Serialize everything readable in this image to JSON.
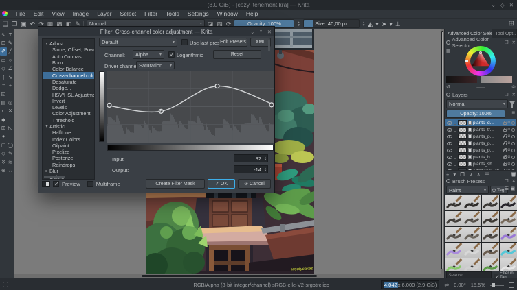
{
  "window": {
    "title": "(3.0 GiB) - [cozy_tenement.kra] — Krita",
    "controls": [
      {
        "name": "minimize",
        "glyph": "⌄"
      },
      {
        "name": "maximize",
        "glyph": "◇"
      },
      {
        "name": "close",
        "glyph": "✕"
      }
    ]
  },
  "menubar": {
    "items": [
      "File",
      "Edit",
      "View",
      "Image",
      "Layer",
      "Select",
      "Filter",
      "Tools",
      "Settings",
      "Window",
      "Help"
    ]
  },
  "toolbar": {
    "left_icons": [
      {
        "name": "new-document",
        "glyph": "❏"
      },
      {
        "name": "open-document",
        "glyph": "❐"
      },
      {
        "name": "save",
        "glyph": "▣"
      },
      {
        "name": "undo",
        "glyph": "↶"
      },
      {
        "name": "redo",
        "glyph": "↷"
      },
      {
        "name": "gradient-chooser",
        "glyph": "▦"
      },
      {
        "name": "pattern-chooser",
        "glyph": "▩"
      },
      {
        "name": "fg-bg-color",
        "glyph": "◧"
      },
      {
        "name": "brush-editor",
        "glyph": "✎"
      }
    ],
    "blend_mode": "Normal",
    "mid_icons": [
      {
        "name": "eraser-mode",
        "glyph": "◪"
      },
      {
        "name": "preserve-alpha",
        "glyph": "▨"
      },
      {
        "name": "reload-preset",
        "glyph": "⟳"
      }
    ],
    "opacity_label": "Opacity: 100%",
    "size_label": "Size: 40,00 px",
    "right_icons": [
      {
        "name": "mirror-horizontal",
        "glyph": "◭"
      },
      {
        "name": "mirror-dropdown",
        "glyph": "▾"
      },
      {
        "name": "mirror-vertical",
        "glyph": "➤"
      },
      {
        "name": "mirror-vertical-dropdown",
        "glyph": "▾"
      },
      {
        "name": "wrap-around",
        "glyph": "⊥"
      }
    ],
    "workspace_icon": "⊞"
  },
  "toolbox": {
    "tools": [
      {
        "name": "select-shapes",
        "glyph": "↖"
      },
      {
        "name": "text",
        "glyph": "T"
      },
      {
        "name": "transform",
        "glyph": "⊡"
      },
      {
        "name": "edit-shapes",
        "glyph": "✎"
      },
      {
        "name": "freehand-brush",
        "glyph": "✐",
        "selected": true
      },
      {
        "name": "line",
        "glyph": "╱"
      },
      {
        "name": "rectangle",
        "glyph": "▭"
      },
      {
        "name": "ellipse",
        "glyph": "○"
      },
      {
        "name": "polygon",
        "glyph": "◇"
      },
      {
        "name": "polyline",
        "glyph": "∠"
      },
      {
        "name": "bezier-curve",
        "glyph": "∫"
      },
      {
        "name": "freehand-path",
        "glyph": "∿"
      },
      {
        "name": "dynamic-brush",
        "glyph": "≈"
      },
      {
        "name": "multibrush",
        "glyph": "+"
      },
      {
        "name": "crop",
        "glyph": "◱"
      },
      {
        "name": "",
        "glyph": ""
      },
      {
        "name": "gradient",
        "glyph": "▤"
      },
      {
        "name": "color-sampler",
        "glyph": "◎"
      },
      {
        "name": "pattern-fill",
        "glyph": "◐"
      },
      {
        "name": "smart-patch",
        "glyph": "✕"
      },
      {
        "name": "fill",
        "glyph": "◆"
      },
      {
        "name": "",
        "glyph": ""
      },
      {
        "name": "assistants",
        "glyph": "⊞"
      },
      {
        "name": "measure",
        "glyph": "◺"
      },
      {
        "name": "reference-images",
        "glyph": "●"
      },
      {
        "name": "",
        "glyph": ""
      },
      {
        "name": "rectangular-select",
        "glyph": "◻"
      },
      {
        "name": "elliptical-select",
        "glyph": "◯"
      },
      {
        "name": "polygonal-select",
        "glyph": "◇"
      },
      {
        "name": "freehand-select",
        "glyph": "✎"
      },
      {
        "name": "contiguous-select",
        "glyph": "※"
      },
      {
        "name": "similar-select",
        "glyph": "≋"
      },
      {
        "name": "zoom",
        "glyph": "⊕"
      },
      {
        "name": "pan",
        "glyph": "↔"
      }
    ]
  },
  "canvas": {
    "signature": "woofycakes"
  },
  "dialog": {
    "title": "Filter: Cross-channel color adjustment — Krita",
    "controls": [
      {
        "name": "shade",
        "glyph": "⌄"
      },
      {
        "name": "rollup",
        "glyph": "⌃"
      },
      {
        "name": "close",
        "glyph": "✕"
      }
    ],
    "preset_value": "Default",
    "use_last_preset_label": "Use last preset",
    "edit_presets_label": "Edit Presets",
    "xml_label": "XML",
    "channel_label": "Channel:",
    "channel_value": "Alpha",
    "logarithmic_label": "Logarithmic",
    "reset_label": "Reset",
    "driver_label": "Driver channel",
    "driver_value": "Saturation",
    "input_label": "Input:",
    "input_value": "32",
    "output_label": "Output:",
    "output_value": "-14",
    "preview_label": "Preview",
    "multiframe_label": "Multiframe",
    "create_filter_mask_label": "Create Filter Mask",
    "ok_label": "OK",
    "cancel_label": "Cancel",
    "filter_tree": [
      {
        "label": "Adjust",
        "level": 0,
        "expanded": true
      },
      {
        "label": "Slope, Offset, Powe",
        "level": 1
      },
      {
        "label": "Auto Contrast",
        "level": 1
      },
      {
        "label": "Burn...",
        "level": 1
      },
      {
        "label": "Color Balance",
        "level": 1
      },
      {
        "label": "Cross-channel colo",
        "level": 1,
        "selected": true
      },
      {
        "label": "Desaturate",
        "level": 1
      },
      {
        "label": "Dodge...",
        "level": 1
      },
      {
        "label": "HSV/HSL Adjustme",
        "level": 1
      },
      {
        "label": "Invert",
        "level": 1
      },
      {
        "label": "Levels",
        "level": 1
      },
      {
        "label": "Color Adjustment",
        "level": 1
      },
      {
        "label": "Threshold",
        "level": 1
      },
      {
        "label": "Artistic",
        "level": 0,
        "expanded": true
      },
      {
        "label": "Halftone",
        "level": 1
      },
      {
        "label": "Index Colors",
        "level": 1
      },
      {
        "label": "Oilpaint",
        "level": 1
      },
      {
        "label": "Pixelize",
        "level": 1
      },
      {
        "label": "Posterize",
        "level": 1
      },
      {
        "label": "Raindrops",
        "level": 1
      },
      {
        "label": "Blur",
        "level": 0,
        "expanded": false
      },
      {
        "label": "Colors",
        "level": 0,
        "expanded": false
      }
    ],
    "curve": {
      "points": [
        {
          "x": 0,
          "y": 0.48
        },
        {
          "x": 0.325,
          "y": 0.565
        },
        {
          "x": 0.66,
          "y": 0.215
        },
        {
          "x": 1,
          "y": 0.475
        }
      ]
    }
  },
  "right_panel": {
    "tabs": [
      {
        "label": "Advanced Color Sele...",
        "active": true
      },
      {
        "label": "Tool Opt...",
        "active": false
      }
    ],
    "acs": {
      "title": "Advanced Color Selector"
    },
    "layers": {
      "title": "Layers",
      "blend_mode": "Normal",
      "opacity_label": "Opacity: 100%",
      "rows": [
        {
          "name": "plants_d...",
          "selected": true
        },
        {
          "name": "plants_tr..."
        },
        {
          "name": "plants_p..."
        },
        {
          "name": "plants_p..."
        },
        {
          "name": "plants_p..."
        },
        {
          "name": "plants_b..."
        },
        {
          "name": "plants_sh..."
        },
        {
          "name": "additional_ob..."
        }
      ],
      "toolbar_icons": [
        {
          "name": "add-layer",
          "glyph": "+"
        },
        {
          "name": "add-layer-dropdown",
          "glyph": "▾"
        },
        {
          "name": "duplicate-layer",
          "glyph": "❐"
        },
        {
          "name": "move-layer-down",
          "glyph": "∨"
        },
        {
          "name": "move-layer-up",
          "glyph": "∧"
        },
        {
          "name": "layer-properties",
          "glyph": "☰"
        }
      ]
    },
    "brushes": {
      "title": "Brush Presets",
      "combo_value": "Paint",
      "tag_label": "Tag",
      "search_placeholder": "Search",
      "filter_label": "Filter in Tag",
      "cells": [
        {
          "stroke": "#35322f"
        },
        {
          "stroke": "#2e2b29"
        },
        {
          "stroke": "#3a3734"
        },
        {
          "stroke": "#26232a"
        },
        {
          "stroke": "#44403c"
        },
        {
          "stroke": "#55504a"
        },
        {
          "stroke": "#3c3833"
        },
        {
          "stroke": "#776a5c"
        },
        {
          "stroke": "#5a554f"
        },
        {
          "stroke": "#6a645c"
        },
        {
          "stroke": "#4e4944"
        },
        {
          "stroke": "#9a79d6"
        },
        {
          "stroke": "#a98bdd"
        },
        {
          "stroke": "#d8d8d8"
        },
        {
          "stroke": "#6a5c4e"
        },
        {
          "stroke": "#57c8d8"
        },
        {
          "stroke": "#86c86a"
        },
        {
          "stroke": "#d0d0d0"
        },
        {
          "stroke": "#5a9a46"
        },
        {
          "stroke": "#e4e4e4"
        }
      ]
    }
  },
  "statusbar": {
    "color_profile": "RGB/Alpha (8-bit integer/channel)  sRGB-elle-V2-srgbtrc.icc",
    "dim_highlight": "4.042",
    "dim_rest": " x 6.000 (2,9 GiB)",
    "angle": "0,00°",
    "zoom": "15,5%"
  },
  "colors": {
    "accent": "#3daee9",
    "slider_fill": "#4f7a9e",
    "selection": "#3d6e9a"
  }
}
